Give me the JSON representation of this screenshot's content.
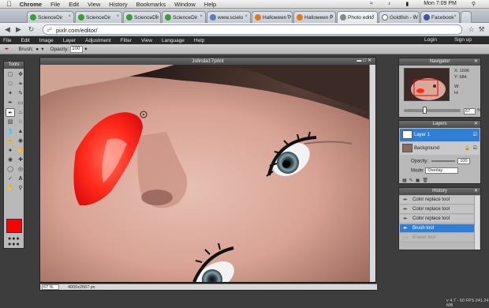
{
  "macbar": {
    "apple": "",
    "app_name": "Chrome",
    "menus": [
      "File",
      "Edit",
      "View",
      "History",
      "Bookmarks",
      "Window",
      "Help"
    ],
    "clock": "Mon 7:09 PM"
  },
  "tabs": [
    {
      "label": "ScienceDir",
      "color": "#3a9d3a"
    },
    {
      "label": "ScienceDir",
      "color": "#3a9d3a"
    },
    {
      "label": "ScienceDir",
      "color": "#3a9d3a"
    },
    {
      "label": "ScienceDir",
      "color": "#3a9d3a"
    },
    {
      "label": "www.scielo",
      "color": "#5a7fb6"
    },
    {
      "label": "Halloween P",
      "color": "#e07a1f"
    },
    {
      "label": "Halloween P",
      "color": "#e07a1f"
    },
    {
      "label": "Photo edito",
      "color": "#888888"
    },
    {
      "label": "Goldfish - W",
      "color": "#666666"
    },
    {
      "label": "Facebook",
      "color": "#3b5998"
    }
  ],
  "address": {
    "url": "pixlr.com/editor/"
  },
  "appmenu": {
    "items": [
      "File",
      "Edit",
      "Image",
      "Layer",
      "Adjustment",
      "Filter",
      "View",
      "Language",
      "Help"
    ],
    "login": "Login",
    "signup": "Sign up"
  },
  "options": {
    "brush_label": "Brush:",
    "opacity_label": "Opacity:",
    "opacity_value": "100"
  },
  "tools": {
    "title": "Tools",
    "swatch_color": "#ff0000"
  },
  "document": {
    "title": "Jolinda17print",
    "zoom": "67",
    "zoom_unit": "%",
    "size": "4000x2667 px"
  },
  "navigator": {
    "title": "Navigator",
    "x_label": "X:",
    "x_value": "1606",
    "y_label": "Y:",
    "y_value": "684",
    "w_label": "W:",
    "h_label": "H:",
    "zoom": "67",
    "zoom_unit": "%"
  },
  "layers": {
    "title": "Layers",
    "items": [
      {
        "name": "Layer 1",
        "selected": true
      },
      {
        "name": "Background",
        "selected": false
      }
    ],
    "opacity_label": "Opacity:",
    "opacity_value": "100",
    "mode_label": "Mode:",
    "mode_value": "Overlay"
  },
  "history": {
    "title": "History",
    "items": [
      {
        "label": "Color replace tool",
        "state": "normal"
      },
      {
        "label": "Color replace tool",
        "state": "normal"
      },
      {
        "label": "Color replace tool",
        "state": "normal"
      },
      {
        "label": "Brush tool",
        "state": "active"
      },
      {
        "label": "Eraser tool",
        "state": "dim"
      }
    ]
  },
  "footer": {
    "version": "v 4.7 - 60 FPS 241.24 MB"
  }
}
